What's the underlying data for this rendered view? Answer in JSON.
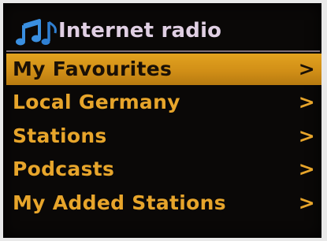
{
  "header": {
    "icon": "music-note-icon",
    "title": "Internet radio"
  },
  "menu": {
    "items": [
      {
        "label": "My Favourites",
        "chevron": ">"
      },
      {
        "label": "Local Germany",
        "chevron": ">"
      },
      {
        "label": "Stations",
        "chevron": ">"
      },
      {
        "label": "Podcasts",
        "chevron": ">"
      },
      {
        "label": "My Added Stations",
        "chevron": ">"
      }
    ],
    "selected": "My Favourites"
  },
  "colors": {
    "text": "#e7a52b",
    "highlight": "#d89a1c",
    "title": "#e0cfe3",
    "icon": "#3a8fe0",
    "background": "#0a0807"
  }
}
